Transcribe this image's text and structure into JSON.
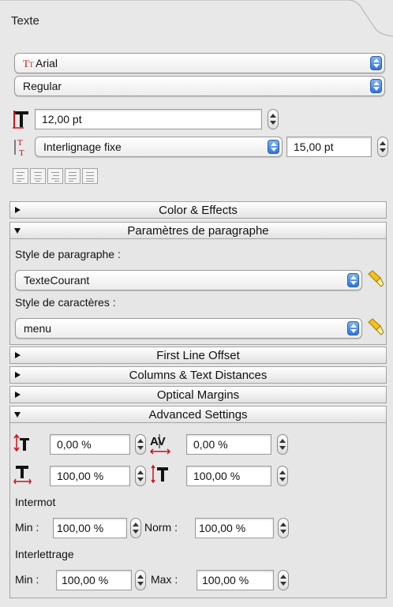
{
  "panel": {
    "title": "Texte",
    "font_family": "Arial",
    "font_style": "Regular",
    "font_size": "12,00 pt",
    "leading_mode": "Interlignage fixe",
    "leading_value": "15,00 pt"
  },
  "sections": {
    "color_effects": "Color & Effects",
    "paragraph_params": "Paramètres de paragraphe",
    "first_line_offset": "First Line Offset",
    "columns_distances": "Columns & Text Distances",
    "optical_margins": "Optical Margins",
    "advanced_settings": "Advanced Settings"
  },
  "paragraph": {
    "para_style_label": "Style de paragraphe :",
    "para_style_value": "TexteCourant",
    "char_style_label": "Style de caractères :",
    "char_style_value": "menu"
  },
  "advanced": {
    "baseline_shift": "0,00 %",
    "tracking": "0,00 %",
    "horizontal_scale": "100,00 %",
    "vertical_scale": "100,00 %",
    "intermot_label": "Intermot",
    "intermot_min_label": "Min :",
    "intermot_min": "100,00 %",
    "intermot_norm_label": "Norm :",
    "intermot_norm": "100,00 %",
    "interlettrage_label": "Interlettrage",
    "interlettrage_min_label": "Min :",
    "interlettrage_min": "100,00 %",
    "interlettrage_max_label": "Max :",
    "interlettrage_max": "100,00 %"
  },
  "colors": {
    "accent_blue": "#2f76d8",
    "icon_red": "#c8141c"
  }
}
